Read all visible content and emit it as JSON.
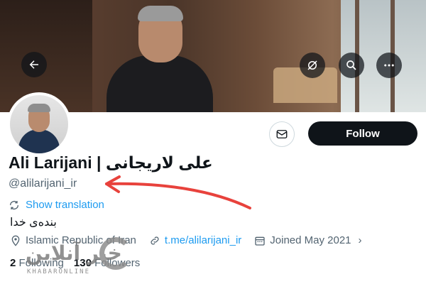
{
  "profile": {
    "display_name": "Ali Larijani | علی لاریجانی",
    "handle": "@alilarijani_ir",
    "bio": "بنده‌ی خدا",
    "show_translation": "Show translation",
    "location": "Islamic Republic of Iran",
    "link": "t.me/alilarijani_ir",
    "joined": "Joined May 2021",
    "following_count": "2",
    "following_label": "Following",
    "followers_count": "130",
    "followers_label": "Followers"
  },
  "actions": {
    "follow_label": "Follow"
  },
  "icons": {
    "back": "back-arrow-icon",
    "stream": "stream-off-icon",
    "search": "search-icon",
    "more": "more-icon",
    "message": "message-icon",
    "translate": "translate-icon",
    "location": "location-pin-icon",
    "link": "link-icon",
    "calendar": "calendar-icon"
  },
  "colors": {
    "accent": "#1d9bf0",
    "follow_bg": "#0f1419",
    "annotation_arrow": "#e8423c"
  },
  "watermark": {
    "text": "خبر آنلاین",
    "sub": "KHABARONLINE"
  }
}
